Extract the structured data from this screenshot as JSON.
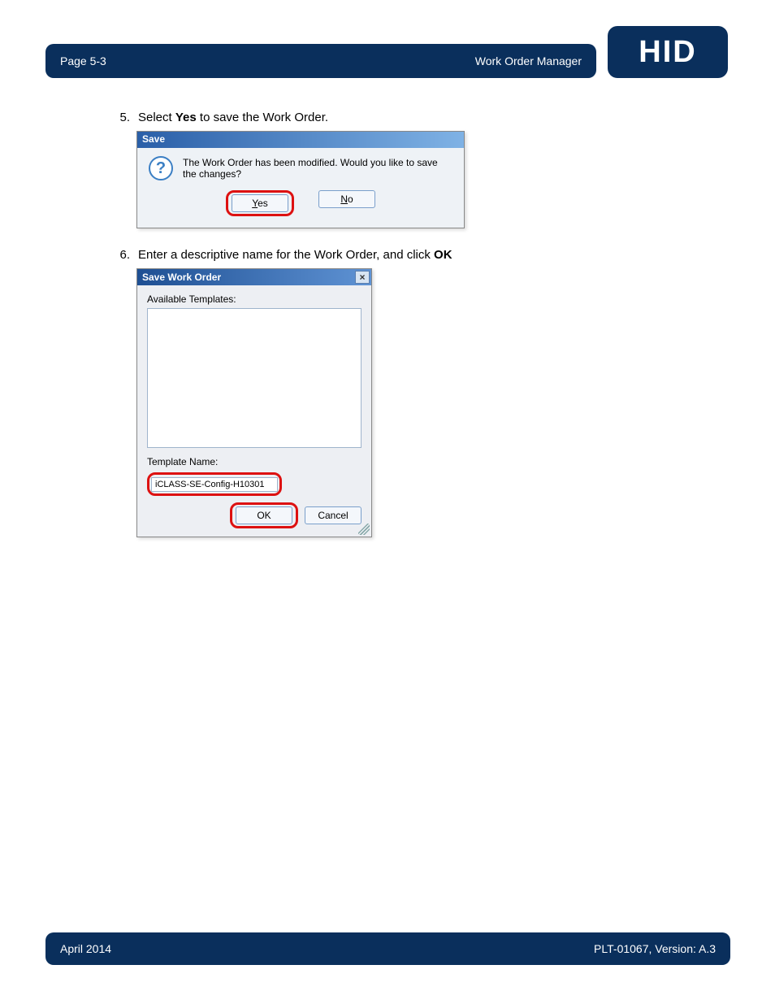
{
  "header": {
    "page_label": "Page 5-3",
    "section_title": "Work Order Manager"
  },
  "logo": {
    "text": "HID"
  },
  "steps": {
    "s5": {
      "num": "5.",
      "pre": "Select ",
      "strong": "Yes",
      "post": " to save the Work Order."
    },
    "s6": {
      "num": "6.",
      "pre": "Enter a descriptive name for the Work Order, and click ",
      "strong": "OK"
    }
  },
  "dialog1": {
    "title": "Save",
    "message": "The Work Order has been modified.  Would you like to save the changes?",
    "yes_prefix": "Y",
    "yes_rest": "es",
    "no_prefix": "N",
    "no_rest": "o"
  },
  "dialog2": {
    "title": "Save Work Order",
    "available_label": "Available Templates:",
    "template_label": "Template Name:",
    "template_value": "iCLASS-SE-Config-H10301",
    "ok": "OK",
    "cancel": "Cancel",
    "close": "×"
  },
  "footer": {
    "left": "April 2014",
    "right": "PLT-01067, Version: A.3"
  }
}
